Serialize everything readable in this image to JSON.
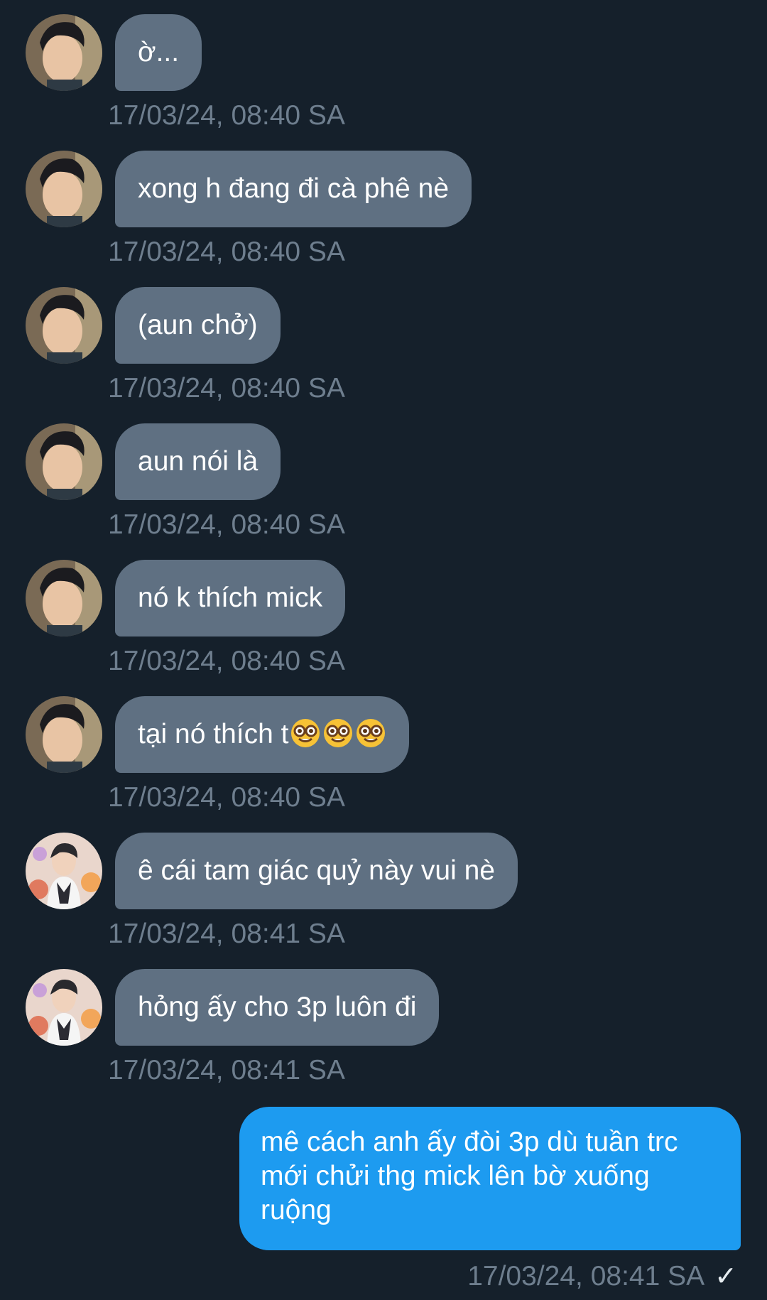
{
  "conversation": {
    "messages": [
      {
        "direction": "in",
        "avatar": "avatar-1",
        "text": "ờ...",
        "time": "17/03/24, 08:40 SA"
      },
      {
        "direction": "in",
        "avatar": "avatar-1",
        "text": "xong h đang đi cà phê nè",
        "time": "17/03/24, 08:40 SA"
      },
      {
        "direction": "in",
        "avatar": "avatar-1",
        "text": "(aun chở)",
        "time": "17/03/24, 08:40 SA"
      },
      {
        "direction": "in",
        "avatar": "avatar-1",
        "text": "aun nói là",
        "time": "17/03/24, 08:40 SA"
      },
      {
        "direction": "in",
        "avatar": "avatar-1",
        "text": "nó k thích mick",
        "time": "17/03/24, 08:40 SA"
      },
      {
        "direction": "in",
        "avatar": "avatar-1",
        "text": "tại nó thích t",
        "emoji": "nerd-face-emoji x3",
        "time": "17/03/24, 08:40 SA"
      },
      {
        "direction": "in",
        "avatar": "avatar-2",
        "text": "ê cái tam giác quỷ này vui nè",
        "time": "17/03/24, 08:41 SA"
      },
      {
        "direction": "in",
        "avatar": "avatar-2",
        "text": "hỏng ấy cho 3p luôn đi",
        "time": "17/03/24, 08:41 SA"
      },
      {
        "direction": "out",
        "text": "mê cách anh ấy đòi 3p dù tuần trc mới chửi thg mick lên bờ xuống ruộng",
        "time": "17/03/24, 08:41 SA",
        "status_icon": "check-icon"
      }
    ]
  },
  "colors": {
    "background": "#15202b",
    "incoming_bubble": "#5f7082",
    "outgoing_bubble": "#1d9bf0",
    "timestamp": "#6e7e8e"
  }
}
